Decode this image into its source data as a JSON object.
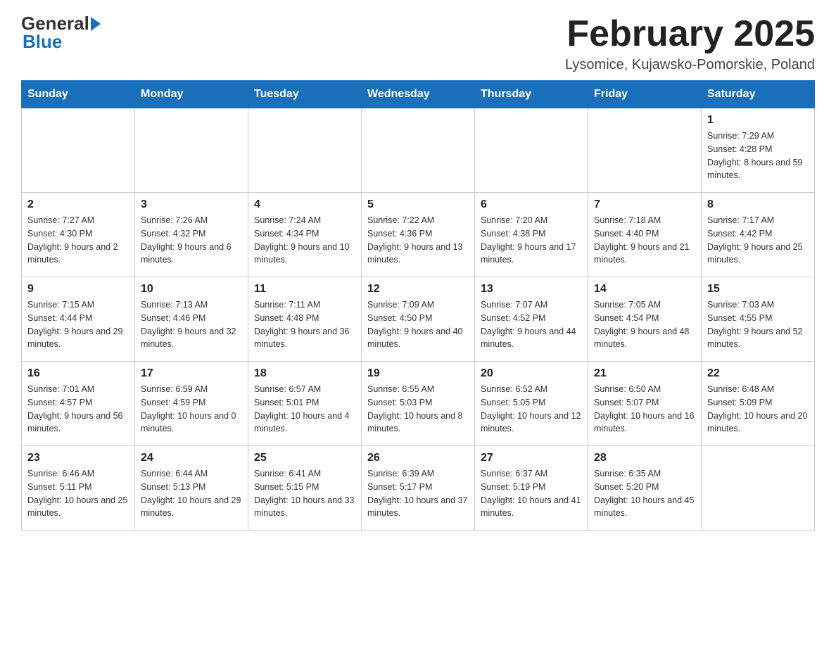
{
  "header": {
    "logo_general": "General",
    "logo_blue": "Blue",
    "title": "February 2025",
    "subtitle": "Lysomice, Kujawsko-Pomorskie, Poland"
  },
  "weekdays": [
    "Sunday",
    "Monday",
    "Tuesday",
    "Wednesday",
    "Thursday",
    "Friday",
    "Saturday"
  ],
  "weeks": [
    [
      {
        "day": "",
        "info": ""
      },
      {
        "day": "",
        "info": ""
      },
      {
        "day": "",
        "info": ""
      },
      {
        "day": "",
        "info": ""
      },
      {
        "day": "",
        "info": ""
      },
      {
        "day": "",
        "info": ""
      },
      {
        "day": "1",
        "info": "Sunrise: 7:29 AM\nSunset: 4:28 PM\nDaylight: 8 hours and 59 minutes."
      }
    ],
    [
      {
        "day": "2",
        "info": "Sunrise: 7:27 AM\nSunset: 4:30 PM\nDaylight: 9 hours and 2 minutes."
      },
      {
        "day": "3",
        "info": "Sunrise: 7:26 AM\nSunset: 4:32 PM\nDaylight: 9 hours and 6 minutes."
      },
      {
        "day": "4",
        "info": "Sunrise: 7:24 AM\nSunset: 4:34 PM\nDaylight: 9 hours and 10 minutes."
      },
      {
        "day": "5",
        "info": "Sunrise: 7:22 AM\nSunset: 4:36 PM\nDaylight: 9 hours and 13 minutes."
      },
      {
        "day": "6",
        "info": "Sunrise: 7:20 AM\nSunset: 4:38 PM\nDaylight: 9 hours and 17 minutes."
      },
      {
        "day": "7",
        "info": "Sunrise: 7:18 AM\nSunset: 4:40 PM\nDaylight: 9 hours and 21 minutes."
      },
      {
        "day": "8",
        "info": "Sunrise: 7:17 AM\nSunset: 4:42 PM\nDaylight: 9 hours and 25 minutes."
      }
    ],
    [
      {
        "day": "9",
        "info": "Sunrise: 7:15 AM\nSunset: 4:44 PM\nDaylight: 9 hours and 29 minutes."
      },
      {
        "day": "10",
        "info": "Sunrise: 7:13 AM\nSunset: 4:46 PM\nDaylight: 9 hours and 32 minutes."
      },
      {
        "day": "11",
        "info": "Sunrise: 7:11 AM\nSunset: 4:48 PM\nDaylight: 9 hours and 36 minutes."
      },
      {
        "day": "12",
        "info": "Sunrise: 7:09 AM\nSunset: 4:50 PM\nDaylight: 9 hours and 40 minutes."
      },
      {
        "day": "13",
        "info": "Sunrise: 7:07 AM\nSunset: 4:52 PM\nDaylight: 9 hours and 44 minutes."
      },
      {
        "day": "14",
        "info": "Sunrise: 7:05 AM\nSunset: 4:54 PM\nDaylight: 9 hours and 48 minutes."
      },
      {
        "day": "15",
        "info": "Sunrise: 7:03 AM\nSunset: 4:55 PM\nDaylight: 9 hours and 52 minutes."
      }
    ],
    [
      {
        "day": "16",
        "info": "Sunrise: 7:01 AM\nSunset: 4:57 PM\nDaylight: 9 hours and 56 minutes."
      },
      {
        "day": "17",
        "info": "Sunrise: 6:59 AM\nSunset: 4:59 PM\nDaylight: 10 hours and 0 minutes."
      },
      {
        "day": "18",
        "info": "Sunrise: 6:57 AM\nSunset: 5:01 PM\nDaylight: 10 hours and 4 minutes."
      },
      {
        "day": "19",
        "info": "Sunrise: 6:55 AM\nSunset: 5:03 PM\nDaylight: 10 hours and 8 minutes."
      },
      {
        "day": "20",
        "info": "Sunrise: 6:52 AM\nSunset: 5:05 PM\nDaylight: 10 hours and 12 minutes."
      },
      {
        "day": "21",
        "info": "Sunrise: 6:50 AM\nSunset: 5:07 PM\nDaylight: 10 hours and 16 minutes."
      },
      {
        "day": "22",
        "info": "Sunrise: 6:48 AM\nSunset: 5:09 PM\nDaylight: 10 hours and 20 minutes."
      }
    ],
    [
      {
        "day": "23",
        "info": "Sunrise: 6:46 AM\nSunset: 5:11 PM\nDaylight: 10 hours and 25 minutes."
      },
      {
        "day": "24",
        "info": "Sunrise: 6:44 AM\nSunset: 5:13 PM\nDaylight: 10 hours and 29 minutes."
      },
      {
        "day": "25",
        "info": "Sunrise: 6:41 AM\nSunset: 5:15 PM\nDaylight: 10 hours and 33 minutes."
      },
      {
        "day": "26",
        "info": "Sunrise: 6:39 AM\nSunset: 5:17 PM\nDaylight: 10 hours and 37 minutes."
      },
      {
        "day": "27",
        "info": "Sunrise: 6:37 AM\nSunset: 5:19 PM\nDaylight: 10 hours and 41 minutes."
      },
      {
        "day": "28",
        "info": "Sunrise: 6:35 AM\nSunset: 5:20 PM\nDaylight: 10 hours and 45 minutes."
      },
      {
        "day": "",
        "info": ""
      }
    ]
  ]
}
